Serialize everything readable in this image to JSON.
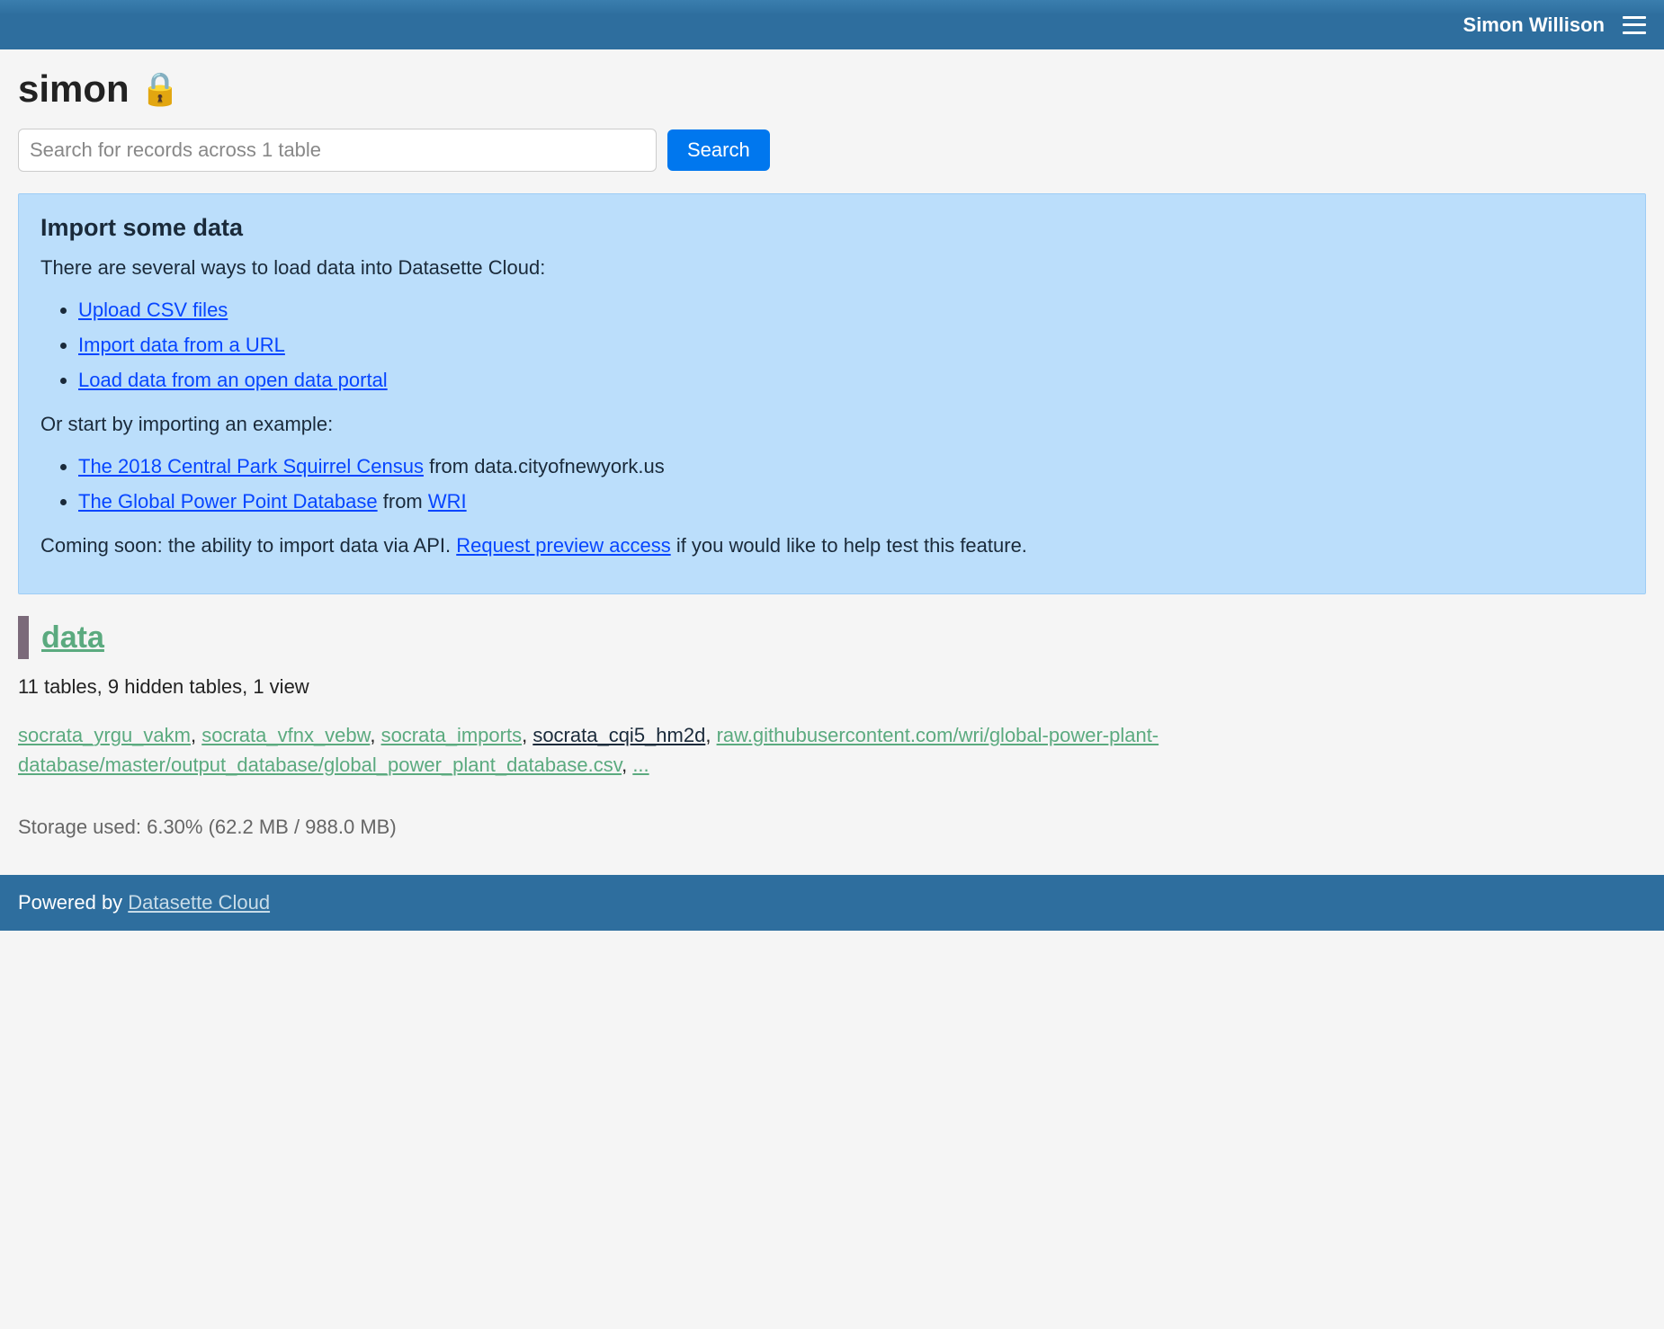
{
  "header": {
    "user_name": "Simon Willison"
  },
  "page": {
    "title": "simon",
    "lock_icon": "🔒"
  },
  "search": {
    "placeholder": "Search for records across 1 table",
    "button_label": "Search"
  },
  "import_panel": {
    "heading": "Import some data",
    "intro": "There are several ways to load data into Datasette Cloud:",
    "options": [
      "Upload CSV files",
      "Import data from a URL",
      "Load data from an open data portal"
    ],
    "examples_intro": "Or start by importing an example:",
    "examples": [
      {
        "link_text": "The 2018 Central Park Squirrel Census",
        "suffix": " from data.cityofnewyork.us"
      },
      {
        "link_text": "The Global Power Point Database",
        "suffix_prefix": " from ",
        "suffix_link": "WRI"
      }
    ],
    "coming_soon_prefix": "Coming soon: the ability to import data via API. ",
    "coming_soon_link": "Request preview access",
    "coming_soon_suffix": " if you would like to help test this feature."
  },
  "database": {
    "name": "data",
    "summary": "11 tables, 9 hidden tables, 1 view",
    "tables": [
      {
        "name": "socrata_yrgu_vakm",
        "dark": false
      },
      {
        "name": "socrata_vfnx_vebw",
        "dark": false
      },
      {
        "name": "socrata_imports",
        "dark": false
      },
      {
        "name": "socrata_cqi5_hm2d",
        "dark": true
      },
      {
        "name": "raw.githubusercontent.com/wri/global-power-plant-database/master/output_database/global_power_plant_database.csv",
        "dark": false
      }
    ],
    "more": "...",
    "storage_text": "Storage used: 6.30% (62.2 MB / 988.0 MB)"
  },
  "footer": {
    "prefix": "Powered by ",
    "link": "Datasette Cloud"
  }
}
